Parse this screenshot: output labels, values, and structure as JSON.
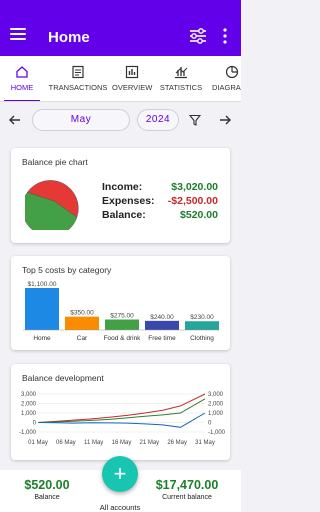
{
  "header": {
    "title": "Home"
  },
  "tabs": [
    {
      "label": "HOME",
      "icon": "home-icon",
      "active": true
    },
    {
      "label": "TRANSACTIONS",
      "icon": "document-icon",
      "active": false
    },
    {
      "label": "OVERVIEW",
      "icon": "bar-chart-icon",
      "active": false
    },
    {
      "label": "STATISTICS",
      "icon": "statistics-icon",
      "active": false
    },
    {
      "label": "DIAGRAMS",
      "icon": "pie-icon",
      "active": false
    }
  ],
  "period": {
    "month": "May",
    "year": "2024"
  },
  "balance_card": {
    "title": "Balance pie chart",
    "income_label": "Income:",
    "income_value": "$3,020.00",
    "expenses_label": "Expenses:",
    "expenses_value": "-$2,500.00",
    "balance_label": "Balance:",
    "balance_value": "$520.00"
  },
  "costs_card": {
    "title": "Top 5 costs by category"
  },
  "development_card": {
    "title": "Balance development"
  },
  "bottom": {
    "left_amount": "$520.00",
    "left_label": "Balance",
    "right_amount": "$17,470.00",
    "right_label": "Current balance",
    "center_label": "All accounts"
  },
  "colors": {
    "accent": "#6200ea",
    "income": "#1b7f2a",
    "expense": "#c62828",
    "fab": "#17c5b0"
  },
  "chart_data": [
    {
      "type": "pie",
      "title": "Balance pie chart",
      "categories": [
        "Income",
        "Expenses"
      ],
      "values": [
        3020,
        2500
      ],
      "colors": [
        "#43a047",
        "#e53935"
      ]
    },
    {
      "type": "bar",
      "title": "Top 5 costs by category",
      "categories": [
        "Home",
        "Car",
        "Food & drink",
        "Free time",
        "Clothing"
      ],
      "values": [
        1100,
        350,
        275,
        240,
        230
      ],
      "value_labels": [
        "$1,100.00",
        "$350.00",
        "$275.00",
        "$240.00",
        "$230.00"
      ],
      "colors": [
        "#1e88e5",
        "#fb8c00",
        "#43a047",
        "#3949ab",
        "#26a69a"
      ]
    },
    {
      "type": "line",
      "title": "Balance development",
      "x": [
        "01 May",
        "06 May",
        "11 May",
        "16 May",
        "21 May",
        "26 May",
        "31 May"
      ],
      "ylim": [
        -1000,
        3000
      ],
      "yticks": [
        "3,000",
        "2,000",
        "1,000",
        "0",
        "-1,000"
      ],
      "series": [
        {
          "color": "#c62828",
          "values": [
            0,
            120,
            250,
            380,
            550,
            750,
            1000,
            1300,
            1750,
            3000
          ]
        },
        {
          "color": "#2e7d32",
          "values": [
            0,
            60,
            130,
            220,
            330,
            480,
            650,
            800,
            1000,
            2500
          ]
        },
        {
          "color": "#1565c0",
          "values": [
            0,
            -30,
            -60,
            -20,
            -40,
            -60,
            -150,
            -250,
            -500,
            1000
          ]
        }
      ]
    }
  ]
}
